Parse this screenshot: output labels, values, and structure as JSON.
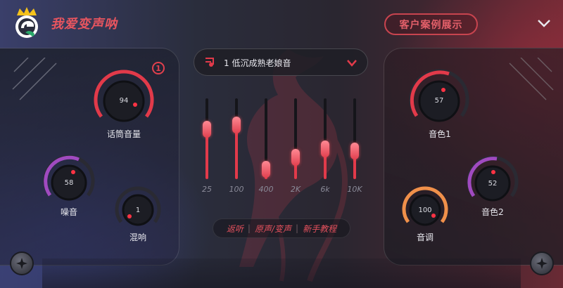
{
  "header": {
    "brand": "我爱变声呐",
    "case_button": "客户案例展示"
  },
  "badge": "1",
  "left_panel": {
    "knobs": [
      {
        "id": "mic-volume",
        "label": "话筒音量",
        "value": "94"
      },
      {
        "id": "noise",
        "label": "噪音",
        "value": "58"
      },
      {
        "id": "reverb",
        "label": "混响",
        "value": "1"
      }
    ]
  },
  "right_panel": {
    "knobs": [
      {
        "id": "timbre1",
        "label": "音色1",
        "value": "57"
      },
      {
        "id": "timbre2",
        "label": "音色2",
        "value": "52"
      },
      {
        "id": "pitch",
        "label": "音调",
        "value": "100"
      }
    ]
  },
  "preset": {
    "value": "1 低沉成熟老娘音"
  },
  "equalizer": {
    "bands": [
      {
        "label": "25",
        "level": 0.62
      },
      {
        "label": "100",
        "level": 0.67
      },
      {
        "label": "400",
        "level": 0.12
      },
      {
        "label": "2K",
        "level": 0.27
      },
      {
        "label": "6k",
        "level": 0.37
      },
      {
        "label": "10K",
        "level": 0.35
      }
    ]
  },
  "links": {
    "back": "返听",
    "original": "原声/变声",
    "tutorial": "新手教程"
  },
  "colors": {
    "accent": "#e23a4a",
    "purple": "#a04ac0",
    "orange": "#f0904a"
  }
}
